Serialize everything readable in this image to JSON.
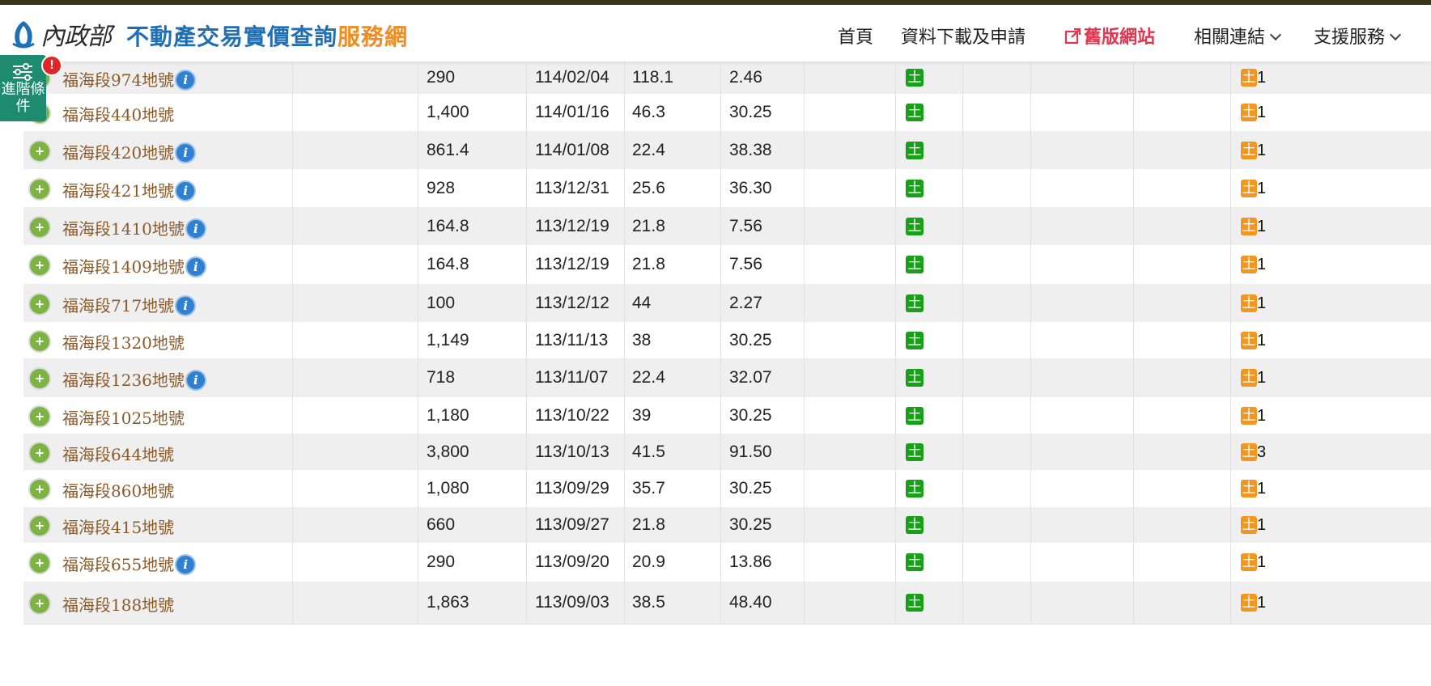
{
  "header": {
    "logo_mark": "內政部",
    "title_main": "不動產交易實價查詢",
    "title_accent": "服務網",
    "nav": [
      {
        "label": "首頁"
      },
      {
        "label": "資料下載及申請"
      },
      {
        "label": "舊版網站"
      },
      {
        "label": "相關連結"
      },
      {
        "label": "支援服務"
      }
    ]
  },
  "advanced": {
    "label": "進階條件",
    "alert": "!"
  },
  "colors": {
    "brand_blue": "#1f6fb5",
    "brand_orange": "#ef8c22",
    "old_site_red": "#e0364e",
    "land_green": "#18a019",
    "land_orange": "#f29622",
    "panel_green": "#1e8a70"
  },
  "icons": {
    "land_badge": "土",
    "info": "i",
    "expand": "+"
  },
  "rows": [
    {
      "address": "福海段974地號",
      "info": true,
      "price": "290",
      "date": "114/02/04",
      "area": "118.1",
      "unit": "2.46",
      "count": "1"
    },
    {
      "address": "福海段440地號",
      "info": false,
      "price": "1,400",
      "date": "114/01/16",
      "area": "46.3",
      "unit": "30.25",
      "count": "1"
    },
    {
      "address": "福海段420地號",
      "info": true,
      "price": "861.4",
      "date": "114/01/08",
      "area": "22.4",
      "unit": "38.38",
      "count": "1"
    },
    {
      "address": "福海段421地號",
      "info": true,
      "price": "928",
      "date": "113/12/31",
      "area": "25.6",
      "unit": "36.30",
      "count": "1"
    },
    {
      "address": "福海段1410地號",
      "info": true,
      "price": "164.8",
      "date": "113/12/19",
      "area": "21.8",
      "unit": "7.56",
      "count": "1"
    },
    {
      "address": "福海段1409地號",
      "info": true,
      "price": "164.8",
      "date": "113/12/19",
      "area": "21.8",
      "unit": "7.56",
      "count": "1"
    },
    {
      "address": "福海段717地號",
      "info": true,
      "price": "100",
      "date": "113/12/12",
      "area": "44",
      "unit": "2.27",
      "count": "1"
    },
    {
      "address": "福海段1320地號",
      "info": false,
      "price": "1,149",
      "date": "113/11/13",
      "area": "38",
      "unit": "30.25",
      "count": "1"
    },
    {
      "address": "福海段1236地號",
      "info": true,
      "price": "718",
      "date": "113/11/07",
      "area": "22.4",
      "unit": "32.07",
      "count": "1"
    },
    {
      "address": "福海段1025地號",
      "info": false,
      "price": "1,180",
      "date": "113/10/22",
      "area": "39",
      "unit": "30.25",
      "count": "1"
    },
    {
      "address": "福海段644地號",
      "info": false,
      "price": "3,800",
      "date": "113/10/13",
      "area": "41.5",
      "unit": "91.50",
      "count": "3"
    },
    {
      "address": "福海段860地號",
      "info": false,
      "price": "1,080",
      "date": "113/09/29",
      "area": "35.7",
      "unit": "30.25",
      "count": "1"
    },
    {
      "address": "福海段415地號",
      "info": false,
      "price": "660",
      "date": "113/09/27",
      "area": "21.8",
      "unit": "30.25",
      "count": "1"
    },
    {
      "address": "福海段655地號",
      "info": true,
      "price": "290",
      "date": "113/09/20",
      "area": "20.9",
      "unit": "13.86",
      "count": "1"
    },
    {
      "address": "福海段188地號",
      "info": false,
      "price": "1,863",
      "date": "113/09/03",
      "area": "38.5",
      "unit": "48.40",
      "count": "1"
    }
  ]
}
